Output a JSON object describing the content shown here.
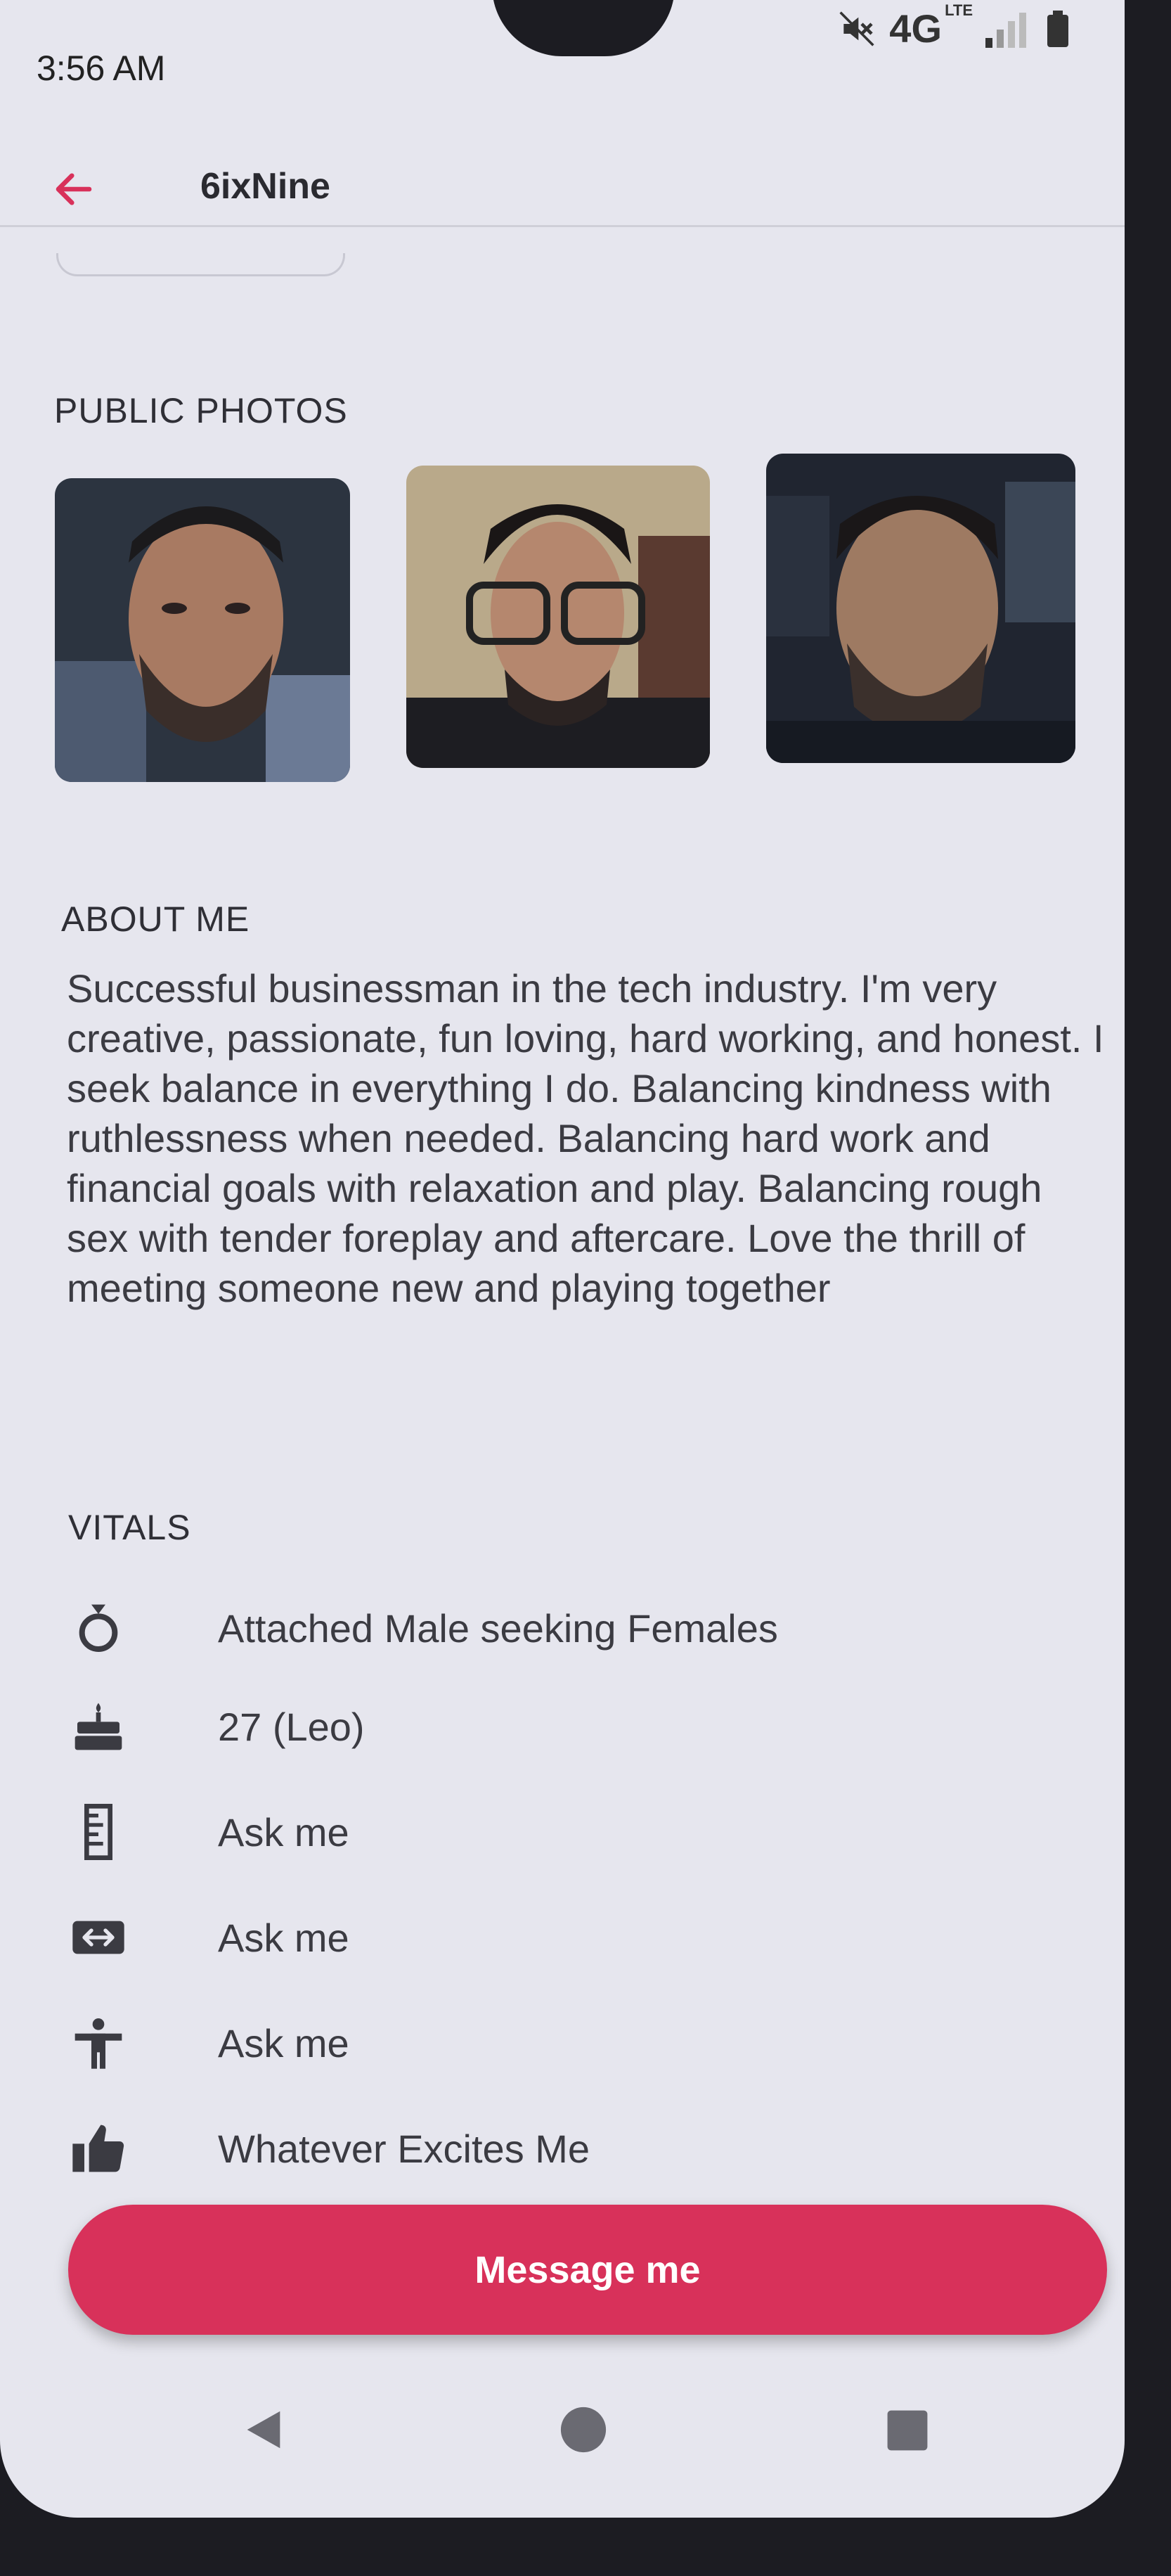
{
  "status_bar": {
    "time": "3:56 AM",
    "network": "4G",
    "network_sub": "LTE",
    "icons": [
      "mute-icon",
      "signal-icon",
      "battery-icon"
    ]
  },
  "header": {
    "title": "6ixNine",
    "back_icon": "back-arrow-icon"
  },
  "public_photos": {
    "title": "PUBLIC PHOTOS",
    "count": 3
  },
  "about": {
    "title": "ABOUT ME",
    "text": "Successful businessman in the tech industry. I'm very creative, passionate, fun loving, hard working, and honest.  I seek balance in everything I do. Balancing kindness with ruthlessness when needed. Balancing hard work and financial goals with relaxation and play. Balancing rough sex with tender foreplay and aftercare. Love the thrill of meeting someone new and playing together"
  },
  "vitals": {
    "title": "VITALS",
    "items": [
      {
        "icon": "relationship-ring-icon",
        "text": "Attached Male seeking Females"
      },
      {
        "icon": "birthday-cake-icon",
        "text": "27 (Leo)"
      },
      {
        "icon": "height-ruler-icon",
        "text": "Ask me"
      },
      {
        "icon": "body-width-icon",
        "text": "Ask me"
      },
      {
        "icon": "body-type-icon",
        "text": "Ask me"
      },
      {
        "icon": "thumbs-up-icon",
        "text": "Whatever Excites Me"
      }
    ]
  },
  "actions": {
    "message_label": "Message me"
  },
  "nav_bar": {
    "icons": [
      "nav-back-icon",
      "nav-home-icon",
      "nav-recent-icon"
    ]
  },
  "colors": {
    "accent": "#d8315a",
    "background": "#e6e6ee",
    "text": "#3b3b42"
  }
}
